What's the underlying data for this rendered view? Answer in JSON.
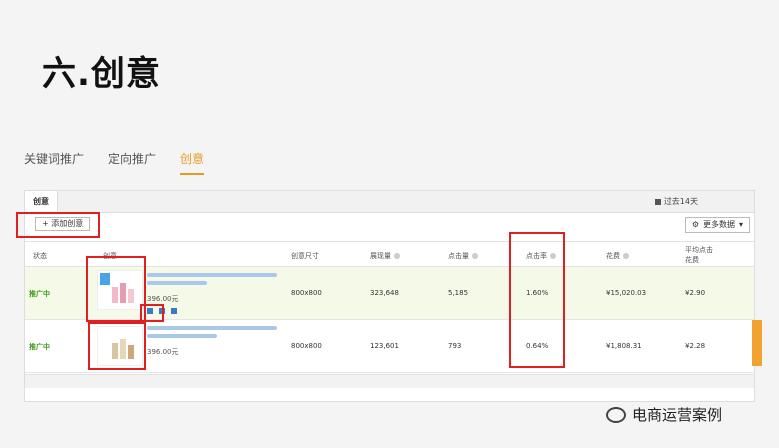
{
  "page_title": "六.创意",
  "tabs": [
    {
      "label": "关键词推广"
    },
    {
      "label": "定向推广"
    },
    {
      "label": "创意"
    }
  ],
  "panel": {
    "tab_label": "创意",
    "period": "过去14天",
    "add_button": "+ 添加创意",
    "more_button": "更多数据"
  },
  "table": {
    "headers": {
      "status": "状态",
      "creative": "创意",
      "size": "创意尺寸",
      "impressions": "展现量",
      "clicks": "点击量",
      "ctr": "点击率",
      "cost": "花费",
      "avg_cpc_line1": "平均点击",
      "avg_cpc_line2": "花费"
    },
    "rows": [
      {
        "status": "推广中",
        "price": "396.00元",
        "size": "800x800",
        "impressions": "323,648",
        "clicks": "5,185",
        "ctr": "1.60%",
        "cost": "¥15,020.03",
        "avg_cpc": "¥2.90"
      },
      {
        "status": "推广中",
        "price": "396.00元",
        "size": "800x800",
        "impressions": "123,601",
        "clicks": "793",
        "ctr": "0.64%",
        "cost": "¥1,808.31",
        "avg_cpc": "¥2.28"
      }
    ]
  },
  "watermark": "电商运营案例",
  "colors": {
    "accent": "#e69c24",
    "status_green": "#3a9a1a",
    "highlight_red": "#e02020"
  },
  "icons": [
    "calendar-icon",
    "gear-icon",
    "chevron-down-icon",
    "help-icon",
    "edit-icon",
    "wechat-icon"
  ]
}
